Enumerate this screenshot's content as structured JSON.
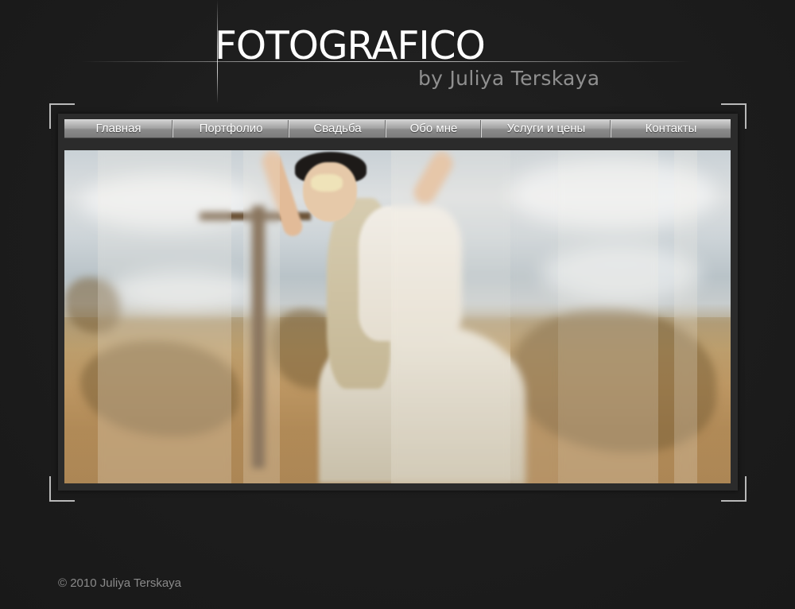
{
  "logo": {
    "title": "FOTOGRAFICO",
    "subtitle": "by Juliya Terskaya"
  },
  "nav": {
    "items": [
      {
        "label": "Главная"
      },
      {
        "label": "Портфолио"
      },
      {
        "label": "Свадьба"
      },
      {
        "label": "Обо мне"
      },
      {
        "label": "Услуги и цены"
      },
      {
        "label": "Контакты"
      }
    ]
  },
  "hero": {
    "image": "photo of a woman in a white top and hat posing in a desert field"
  },
  "footer": {
    "copyright": "© 2010 Juliya Terskaya"
  },
  "colors": {
    "background": "#1c1c1c",
    "frame_box": "#2b2b2b",
    "corner_brackets": "#b9b9b9",
    "logo_title": "#ffffff",
    "logo_subtitle": "#8f8f8f",
    "footer_text": "#8a8a8a"
  }
}
